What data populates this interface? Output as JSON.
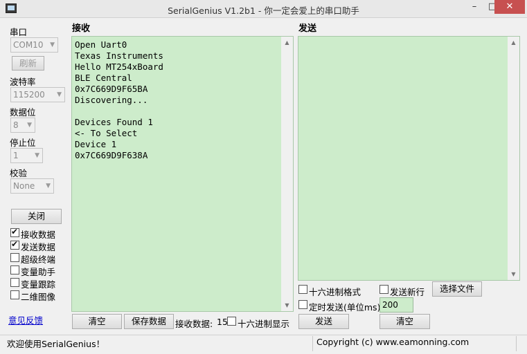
{
  "window": {
    "title": "SerialGenius V1.2b1 - 你一定会爱上的串口助手",
    "min": "–",
    "max": "□",
    "close": "✕"
  },
  "left": {
    "port_label": "串口",
    "port_value": "COM10",
    "refresh": "刷新",
    "baud_label": "波特率",
    "baud_value": "115200",
    "databits_label": "数据位",
    "databits_value": "8",
    "stopbits_label": "停止位",
    "stopbits_value": "1",
    "parity_label": "校验",
    "parity_value": "None",
    "close_button": "关闭",
    "checks": [
      {
        "label": "接收数据",
        "checked": true
      },
      {
        "label": "发送数据",
        "checked": true
      },
      {
        "label": "超级终端",
        "checked": false
      },
      {
        "label": "变量助手",
        "checked": false
      },
      {
        "label": "变量跟踪",
        "checked": false
      },
      {
        "label": "二维图像",
        "checked": false
      }
    ],
    "feedback": "意见反馈"
  },
  "receive": {
    "header": "接收",
    "text": "Open Uart0\nTexas Instruments\nHello MT254xBoard\nBLE Central\n0x7C669D9F65BA\nDiscovering...\n\nDevices Found 1\n<- To Select\nDevice 1\n0x7C669D9F638A",
    "clear": "清空",
    "save": "保存数据",
    "count_label": "接收数据:",
    "count_value": "15",
    "hex_label": "十六进制显示"
  },
  "send": {
    "header": "发送",
    "hex_label": "十六进制格式",
    "newline_label": "发送新行",
    "choose_file": "选择文件",
    "timer_label": "定时发送(单位ms)",
    "timer_value": "200",
    "send": "发送",
    "clear": "清空"
  },
  "status": {
    "left": "欢迎使用SerialGenius！",
    "right": "Copyright (c) www.eamonning.com"
  }
}
